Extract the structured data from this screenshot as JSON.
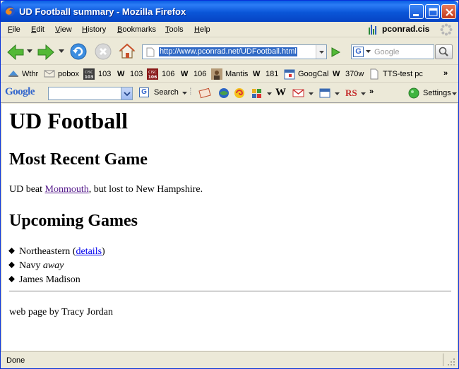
{
  "window": {
    "title": "UD Football summary - Mozilla Firefox"
  },
  "menu": {
    "items": [
      {
        "label": "File",
        "key": "F",
        "rest": "ile"
      },
      {
        "label": "Edit",
        "key": "E",
        "rest": "dit"
      },
      {
        "label": "View",
        "key": "V",
        "rest": "iew"
      },
      {
        "label": "History",
        "key": "H",
        "rest": "istory"
      },
      {
        "label": "Bookmarks",
        "key": "B",
        "rest": "ookmarks"
      },
      {
        "label": "Tools",
        "key": "T",
        "rest": "ools"
      },
      {
        "label": "Help",
        "key": "H",
        "rest": "elp"
      }
    ],
    "profile": "pconrad.cis"
  },
  "nav": {
    "url": "http://www.pconrad.net/UDFootball.html",
    "search_placeholder": "Google",
    "search_engine_letter": "G"
  },
  "bookmarks": [
    {
      "label": "Wthr",
      "icon": "weather-icon"
    },
    {
      "label": "pobox",
      "icon": "mail-icon"
    },
    {
      "label": "103",
      "icon": "cisc103-icon",
      "badge": "CISC 103"
    },
    {
      "label": "103",
      "icon": "w-icon"
    },
    {
      "label": "106",
      "icon": "cisc106-icon",
      "badge": "CISC 106"
    },
    {
      "label": "106",
      "icon": "w-icon"
    },
    {
      "label": "Mantis",
      "icon": "mantis-icon"
    },
    {
      "label": "181",
      "icon": "w-icon"
    },
    {
      "label": "GoogCal",
      "icon": "calendar-icon"
    },
    {
      "label": "370w",
      "icon": "w-icon"
    },
    {
      "label": "TTS-test pc",
      "icon": "page-icon"
    }
  ],
  "google_toolbar": {
    "logo": "Google",
    "search_label": "Search",
    "settings_label": "Settings",
    "wiki_letter": "W",
    "rs_label": "RS"
  },
  "page": {
    "h1": "UD Football",
    "recent_heading": "Most Recent Game",
    "recent_pre": "UD beat ",
    "recent_link": "Monmouth",
    "recent_post": ", but lost to New Hampshire.",
    "upcoming_heading": "Upcoming Games",
    "games": [
      {
        "name": "Northeastern",
        "pre": " (",
        "link": "details",
        "post": ")"
      },
      {
        "name": "Navy ",
        "emph": "away"
      },
      {
        "name": "James Madison"
      }
    ],
    "footer": "web page by Tracy Jordan"
  },
  "status": {
    "text": "Done"
  },
  "colors": {
    "titlebar": "#0a56d8",
    "visited_link": "#551a8b",
    "link": "#0000ee",
    "url_highlight": "#316ac5"
  }
}
